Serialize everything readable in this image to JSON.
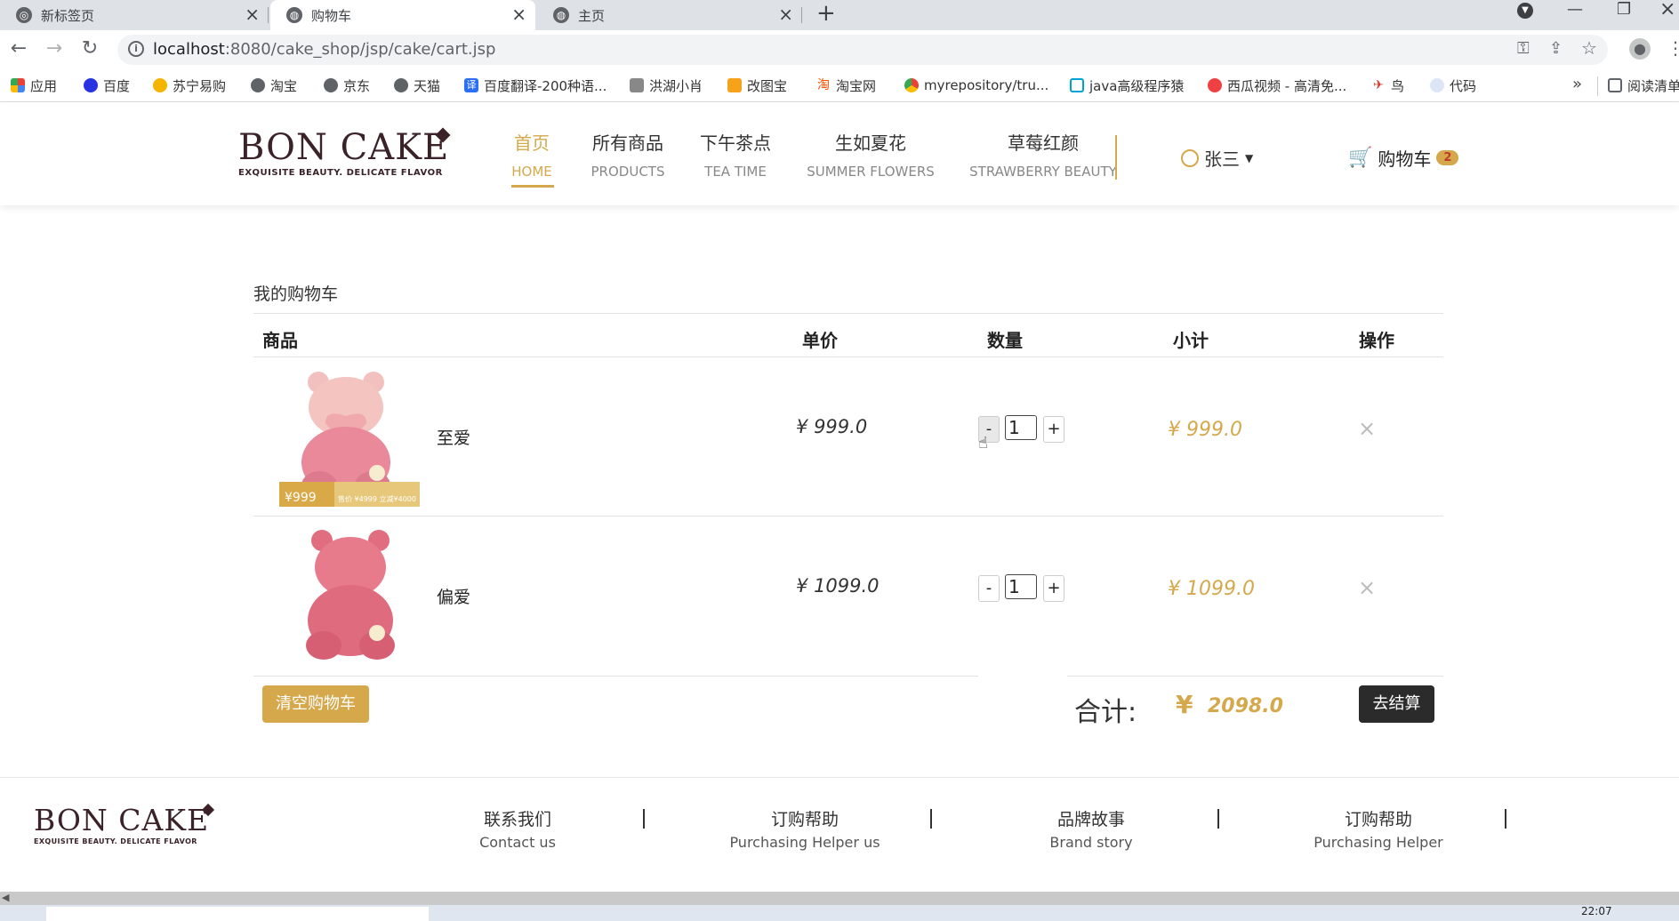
{
  "browser": {
    "tabs": [
      {
        "label": "新标签页",
        "active": false
      },
      {
        "label": "购物车",
        "active": true
      },
      {
        "label": "主页",
        "active": false
      }
    ],
    "url_host": "localhost",
    "url_rest": ":8080/cake_shop/jsp/cake/cart.jsp",
    "bookmarks": [
      "应用",
      "百度",
      "苏宁易购",
      "淘宝",
      "京东",
      "天猫",
      "百度翻译-200种语...",
      "洪湖小肖",
      "改图宝",
      "淘宝网",
      "myrepository/tru...",
      "java高级程序猿",
      "西瓜视频 - 高清免...",
      "鸟",
      "代码"
    ],
    "bookmark_overflow": "»",
    "reading_list": "阅读清单",
    "new_tab_symbol": "+"
  },
  "header": {
    "logo_main": "BON CAKE",
    "logo_sub": "EXQUISITE BEAUTY. DELICATE FLAVOR",
    "nav": [
      {
        "cn": "首页",
        "en": "HOME"
      },
      {
        "cn": "所有商品",
        "en": "PRODUCTS"
      },
      {
        "cn": "下午茶点",
        "en": "TEA TIME"
      },
      {
        "cn": "生如夏花",
        "en": "SUMMER FLOWERS"
      },
      {
        "cn": "草莓红颜",
        "en": "STRAWBERRY BEAUTY"
      }
    ],
    "user_name": "张三",
    "cart_label": "购物车",
    "cart_count": "2"
  },
  "cart": {
    "title": "我的购物车",
    "columns": [
      "商品",
      "单价",
      "数量",
      "小计",
      "操作"
    ],
    "items": [
      {
        "name": "至爱",
        "price": "999.0",
        "qty": "1",
        "subtotal": "999.0",
        "image_tag_left": "¥999",
        "image_tag_right": "售价 ¥4999 立减¥4000"
      },
      {
        "name": "偏爱",
        "price": "1099.0",
        "qty": "1",
        "subtotal": "1099.0"
      }
    ],
    "currency": "¥",
    "minus": "-",
    "plus": "+",
    "remove": "×",
    "clear_label": "清空购物车",
    "total_label": "合计:",
    "total": "2098.0",
    "checkout_label": "去结算"
  },
  "footer": {
    "logo_main": "BON CAKE",
    "logo_sub": "EXQUISITE BEAUTY. DELICATE FLAVOR",
    "links": [
      {
        "cn": "联系我们",
        "en": "Contact us"
      },
      {
        "cn": "订购帮助",
        "en": "Purchasing Helper us"
      },
      {
        "cn": "品牌故事",
        "en": "Brand story"
      },
      {
        "cn": "订购帮助",
        "en": "Purchasing Helper"
      }
    ]
  },
  "taskbar": {
    "clock": "22:07"
  },
  "colors": {
    "accent": "#d4a84b",
    "dark": "#2b2b2b",
    "logo": "#3a2228"
  }
}
